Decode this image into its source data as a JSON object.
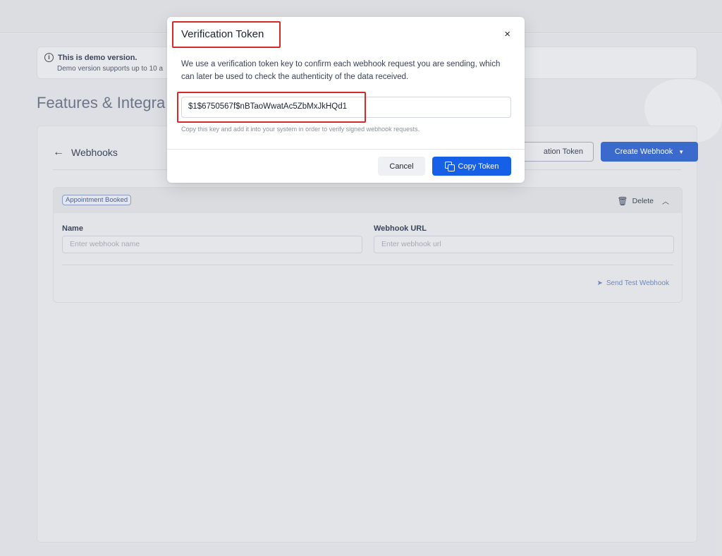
{
  "banner": {
    "title": "This is demo version.",
    "subtitle": "Demo version supports up to 10 a"
  },
  "page": {
    "title": "Features & Integra"
  },
  "webhooks": {
    "back_label": "Webhooks",
    "verification_button": "ation Token",
    "create_button": "Create Webhook",
    "panel": {
      "badge": "Appointment Booked",
      "delete_label": "Delete",
      "name_label": "Name",
      "name_placeholder": "Enter webhook name",
      "url_label": "Webhook URL",
      "url_placeholder": "Enter webhook url",
      "send_test_label": "Send Test Webhook"
    }
  },
  "modal": {
    "title": "Verification Token",
    "close": "×",
    "description": "We use a verification token key to confirm each webhook request you are sending, which can later be used to check the authenticity of the data received.",
    "token": "$1$6750567f$nBTaoWwatAc5ZbMxJkHQd1",
    "hint": "Copy this key and add it into your system in order to verify signed webhook requests.",
    "cancel": "Cancel",
    "copy": "Copy Token"
  },
  "icons": {
    "info": "info-icon",
    "back": "arrow-left-icon",
    "caret": "caret-down-icon",
    "trash": "trash-icon",
    "chevron": "chevron-up-icon",
    "send": "paper-plane-icon",
    "close": "close-icon",
    "copy": "copy-icon"
  },
  "colors": {
    "primary": "#1660e8",
    "highlight": "#d42a2a"
  }
}
